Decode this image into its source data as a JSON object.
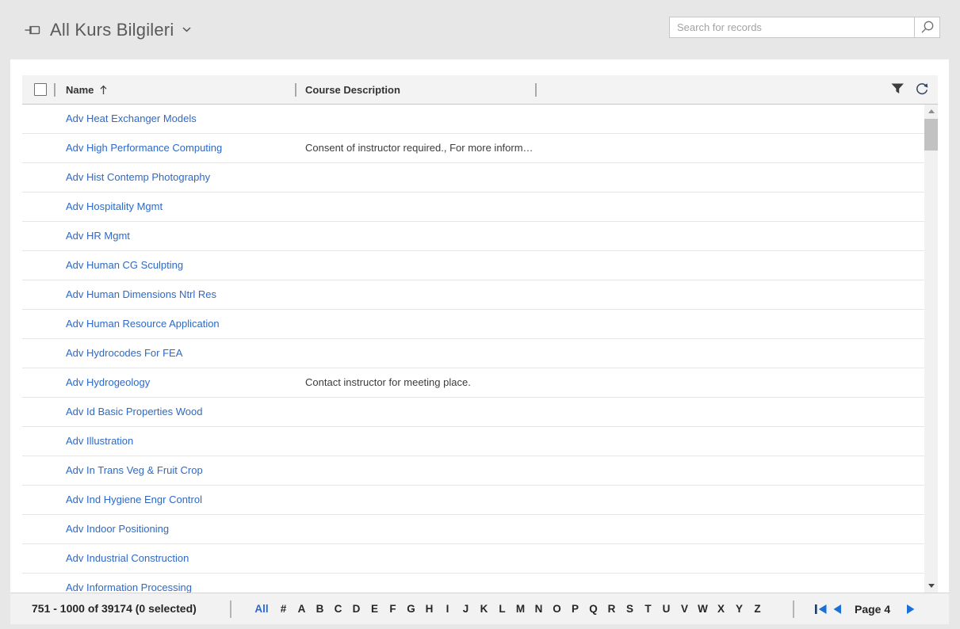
{
  "view": {
    "title": "All Kurs Bilgileri"
  },
  "search": {
    "placeholder": "Search for records"
  },
  "grid": {
    "columns": {
      "name": "Name",
      "description": "Course Description"
    },
    "sort": {
      "column": "Name",
      "direction": "ascending"
    },
    "rows": [
      {
        "name": "Adv Heat Exchanger Models",
        "description": ""
      },
      {
        "name": "Adv High Performance Computing",
        "description": "Consent of instructor required., For more inform…"
      },
      {
        "name": "Adv Hist Contemp Photography",
        "description": ""
      },
      {
        "name": "Adv Hospitality Mgmt",
        "description": ""
      },
      {
        "name": "Adv HR Mgmt",
        "description": ""
      },
      {
        "name": "Adv Human CG Sculpting",
        "description": ""
      },
      {
        "name": "Adv Human Dimensions Ntrl Res",
        "description": ""
      },
      {
        "name": "Adv Human Resource Application",
        "description": ""
      },
      {
        "name": "Adv Hydrocodes For FEA",
        "description": ""
      },
      {
        "name": "Adv Hydrogeology",
        "description": "Contact instructor for meeting place."
      },
      {
        "name": "Adv Id Basic Properties Wood",
        "description": ""
      },
      {
        "name": "Adv Illustration",
        "description": ""
      },
      {
        "name": "Adv In Trans Veg & Fruit Crop",
        "description": ""
      },
      {
        "name": "Adv Ind Hygiene Engr Control",
        "description": ""
      },
      {
        "name": "Adv Indoor Positioning",
        "description": ""
      },
      {
        "name": "Adv Industrial Construction",
        "description": ""
      },
      {
        "name": "Adv Information Processing",
        "description": ""
      }
    ]
  },
  "footer": {
    "record_count": "751 - 1000 of 39174 (0 selected)",
    "jump_all": "All",
    "jump_letters": [
      "#",
      "A",
      "B",
      "C",
      "D",
      "E",
      "F",
      "G",
      "H",
      "I",
      "J",
      "K",
      "L",
      "M",
      "N",
      "O",
      "P",
      "Q",
      "R",
      "S",
      "T",
      "U",
      "V",
      "W",
      "X",
      "Y",
      "Z"
    ],
    "page_label": "Page 4"
  },
  "colors": {
    "accent": "#2d69c8",
    "pager_blue": "#1a6fd9",
    "icon_dark": "#3d3d3d"
  }
}
